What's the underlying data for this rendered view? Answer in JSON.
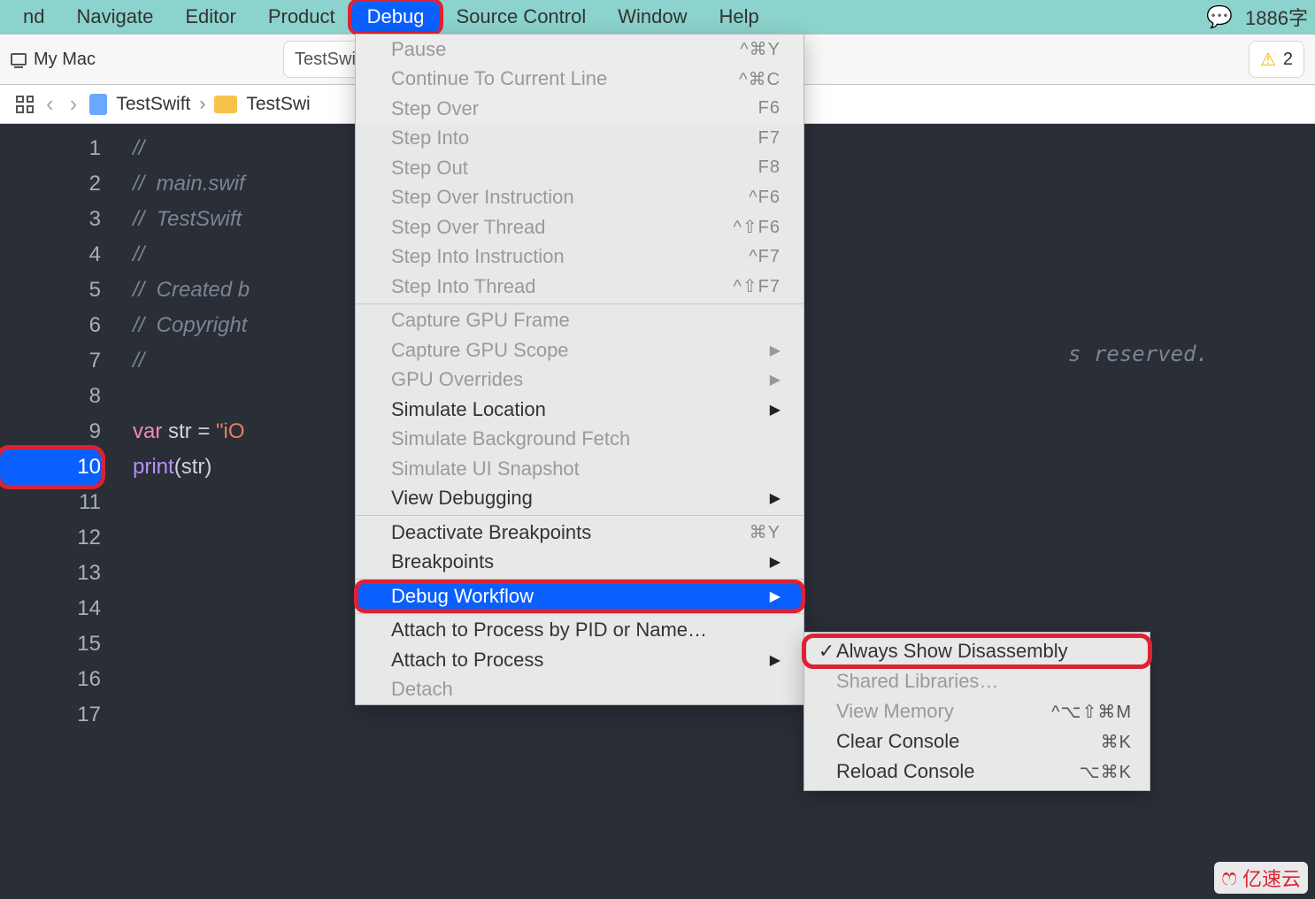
{
  "menubar": {
    "items": [
      "nd",
      "Navigate",
      "Editor",
      "Product",
      "Debug",
      "Source Control",
      "Window",
      "Help"
    ],
    "highlighted_index": 4,
    "right_text": "1886字"
  },
  "toolbar": {
    "device": "My Mac",
    "center_text": "TestSwi",
    "warning_count": "2"
  },
  "pathbar": {
    "crumb1": "TestSwift",
    "crumb2": "TestSwi"
  },
  "code": {
    "lines": [
      {
        "n": "1",
        "frag": [
          {
            "cls": "c",
            "t": "//"
          }
        ]
      },
      {
        "n": "2",
        "frag": [
          {
            "cls": "c",
            "t": "//  main.swif"
          }
        ]
      },
      {
        "n": "3",
        "frag": [
          {
            "cls": "c",
            "t": "//  TestSwift"
          }
        ]
      },
      {
        "n": "4",
        "frag": [
          {
            "cls": "c",
            "t": "//"
          }
        ]
      },
      {
        "n": "5",
        "frag": [
          {
            "cls": "c",
            "t": "//  Created b"
          }
        ]
      },
      {
        "n": "6",
        "frag": [
          {
            "cls": "c",
            "t": "//  Copyright"
          }
        ]
      },
      {
        "n": "7",
        "frag": [
          {
            "cls": "c",
            "t": "//"
          }
        ]
      },
      {
        "n": "8",
        "frag": []
      },
      {
        "n": "9",
        "frag": [
          {
            "cls": "k",
            "t": "var "
          },
          {
            "cls": "v",
            "t": "str = "
          },
          {
            "cls": "s",
            "t": "\"iO"
          }
        ]
      },
      {
        "n": "10",
        "bp": true,
        "frag": [
          {
            "cls": "f",
            "t": "print"
          },
          {
            "cls": "p",
            "t": "("
          },
          {
            "cls": "v",
            "t": "str"
          },
          {
            "cls": "p",
            "t": ")"
          }
        ]
      },
      {
        "n": "11",
        "frag": []
      },
      {
        "n": "12",
        "frag": []
      },
      {
        "n": "13",
        "frag": []
      },
      {
        "n": "14",
        "frag": []
      },
      {
        "n": "15",
        "frag": []
      },
      {
        "n": "16",
        "frag": []
      },
      {
        "n": "17",
        "frag": []
      }
    ],
    "right_comment": "s reserved."
  },
  "debug_menu": [
    {
      "label": "Pause",
      "sc": "^⌘Y",
      "disabled": true
    },
    {
      "label": "Continue To Current Line",
      "sc": "^⌘C",
      "disabled": true
    },
    {
      "label": "Step Over",
      "sc": "F6",
      "disabled": true
    },
    {
      "label": "Step Into",
      "sc": "F7",
      "disabled": true
    },
    {
      "label": "Step Out",
      "sc": "F8",
      "disabled": true
    },
    {
      "label": "Step Over Instruction",
      "sc": "^F6",
      "disabled": true
    },
    {
      "label": "Step Over Thread",
      "sc": "^⇧F6",
      "disabled": true
    },
    {
      "label": "Step Into Instruction",
      "sc": "^F7",
      "disabled": true
    },
    {
      "label": "Step Into Thread",
      "sc": "^⇧F7",
      "disabled": true
    },
    {
      "sep": true
    },
    {
      "label": "Capture GPU Frame",
      "disabled": true
    },
    {
      "label": "Capture GPU Scope",
      "disabled": true,
      "submenu": true
    },
    {
      "label": "GPU Overrides",
      "disabled": true,
      "submenu": true
    },
    {
      "label": "Simulate Location",
      "submenu": true
    },
    {
      "label": "Simulate Background Fetch",
      "disabled": true
    },
    {
      "label": "Simulate UI Snapshot",
      "disabled": true
    },
    {
      "label": "View Debugging",
      "submenu": true
    },
    {
      "sep": true
    },
    {
      "label": "Deactivate Breakpoints",
      "sc": "⌘Y"
    },
    {
      "label": "Breakpoints",
      "submenu": true
    },
    {
      "sep": true
    },
    {
      "label": "Debug Workflow",
      "submenu": true,
      "selected": true,
      "callout": true
    },
    {
      "sep": true
    },
    {
      "label": "Attach to Process by PID or Name…"
    },
    {
      "label": "Attach to Process",
      "submenu": true
    },
    {
      "label": "Detach",
      "disabled": true
    }
  ],
  "submenu": [
    {
      "label": "Always Show Disassembly",
      "checked": true,
      "callout": true
    },
    {
      "label": "Shared Libraries…",
      "disabled": true
    },
    {
      "label": "View Memory",
      "sc": "^⌥⇧⌘M",
      "disabled": true
    },
    {
      "label": "Clear Console",
      "sc": "⌘K"
    },
    {
      "label": "Reload Console",
      "sc": "⌥⌘K"
    }
  ],
  "watermark": "亿速云"
}
